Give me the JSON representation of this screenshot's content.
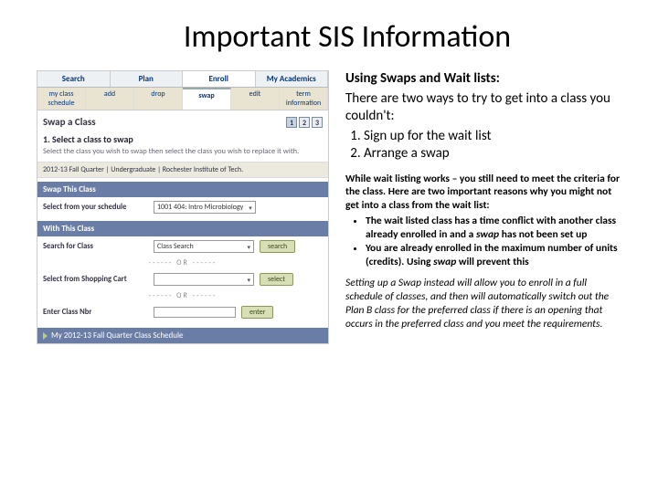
{
  "title": "Important SIS Information",
  "sis": {
    "tabs1": [
      "Search",
      "Plan",
      "Enroll",
      "My Academics"
    ],
    "tabs1_active": 2,
    "tabs2": [
      "my class schedule",
      "add",
      "drop",
      "swap",
      "edit",
      "term information"
    ],
    "tabs2_active": 3,
    "swap_header": "Swap a Class",
    "steps": [
      "1",
      "2",
      "3"
    ],
    "step_title": "1.  Select a class to swap",
    "step_desc": "Select the class you wish to swap then select the class you wish to replace it with.",
    "term_line": "2012-13 Fall Quarter | Undergraduate | Rochester Institute of Tech.",
    "bar_swap_this": "Swap This Class",
    "label_select_schedule": "Select from your schedule",
    "schedule_value": "1001 404: Intro Microbiology",
    "bar_with_this": "With This Class",
    "label_search": "Search for Class",
    "search_value": "Class Search",
    "btn_search": "search",
    "or": "------ OR ------",
    "label_cart": "Select from Shopping Cart",
    "btn_select": "select",
    "label_nbr": "Enter Class Nbr",
    "btn_enter": "enter",
    "accordion": "My 2012-13 Fall Quarter Class Schedule"
  },
  "right": {
    "heading": "Using Swaps and Wait lists:",
    "intro": "There are two ways to try to get into a class you couldn't:",
    "n1": "Sign up for the wait list",
    "n2": "Arrange a swap",
    "p_wait": "While wait listing works – you still need to meet the criteria for the class.  Here are two important reasons why you might not get into a class from the wait list:",
    "b1a": "The wait listed class has a time conflict with another class already enrolled in and a ",
    "b1b": "swap",
    "b1c": " has not been set up",
    "b2a": "You are already enrolled in the maximum number of units (credits). Using ",
    "b2b": "swap",
    "b2c": " will prevent this",
    "p_swap": "Setting up a Swap instead will allow you to enroll in a full schedule of classes, and then will automatically switch out the Plan B class for the preferred class if there is an opening that occurs in the preferred class and you meet the requirements."
  }
}
